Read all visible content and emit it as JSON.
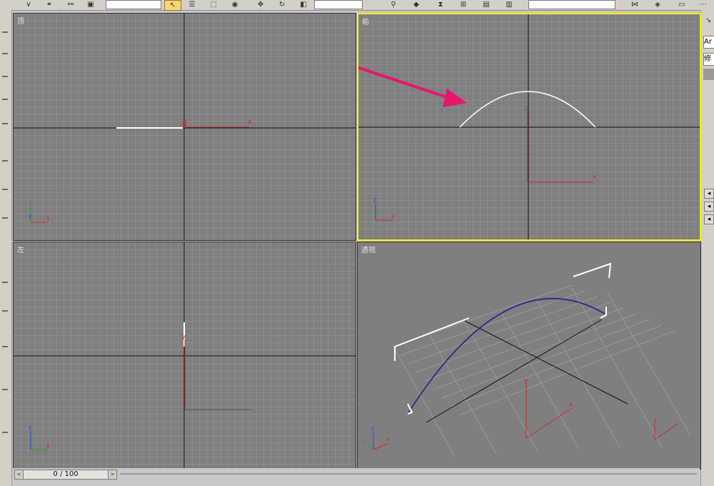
{
  "viewports": {
    "top": {
      "label": "顶"
    },
    "front": {
      "label": "前"
    },
    "left": {
      "label": "左"
    },
    "perspective": {
      "label": "透视"
    }
  },
  "axis_labels": {
    "x": "x",
    "y": "y",
    "z": "z"
  },
  "time_slider": {
    "value": "0 / 100",
    "left_arrow": "<",
    "right_arrow": ">"
  },
  "command_panel": {
    "field_1": "Ar",
    "field_2": "修"
  },
  "colors": {
    "viewport_bg": "#7f7f7f",
    "grid": "#999999",
    "active_border": "#f0f000",
    "arrow": "#e8156e",
    "curve_front": "#ffffff",
    "curve_persp": "#1e1e8c",
    "axis_x": "#d22828",
    "axis_y": "#2aa02a",
    "axis_z": "#3a3aff"
  },
  "icons": [
    "select-icon",
    "select-region-icon",
    "move-icon",
    "rotate-icon",
    "mirror-icon",
    "align-icon",
    "material-icon",
    "render-icon",
    "layer-icon"
  ]
}
